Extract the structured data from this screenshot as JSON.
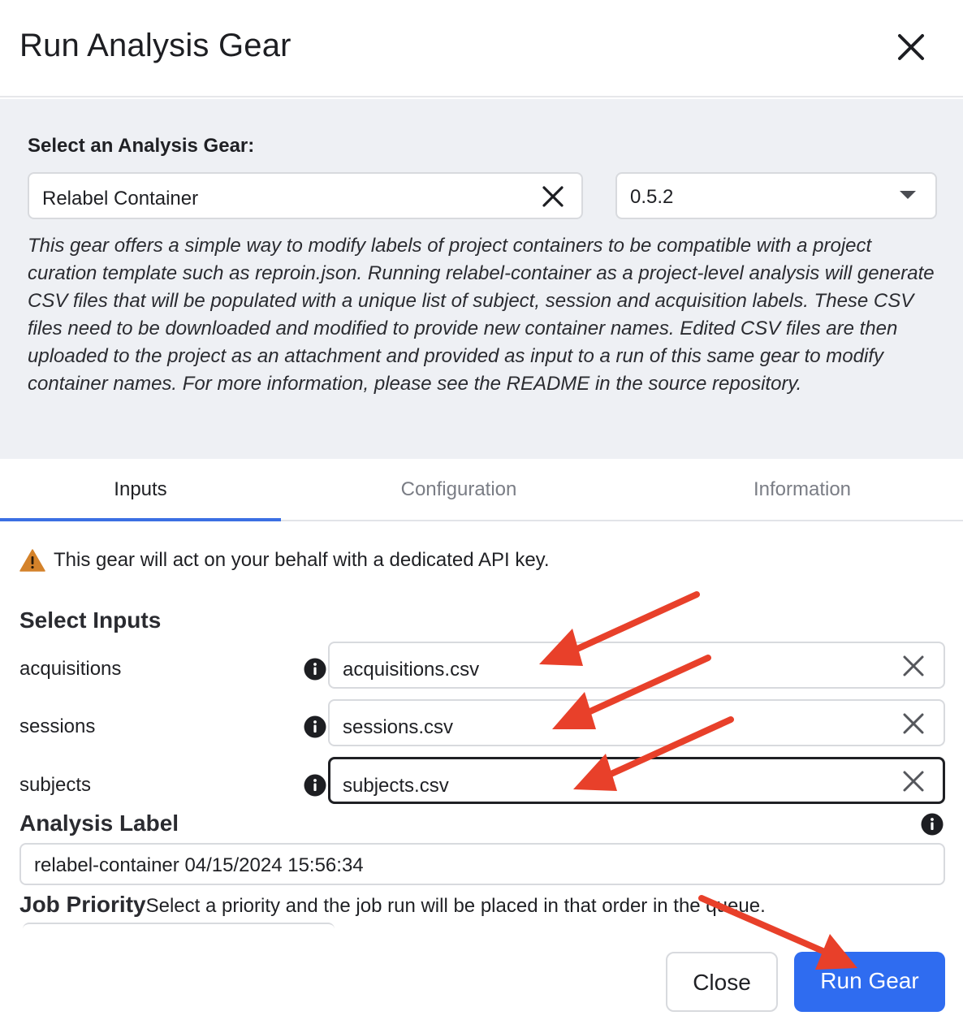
{
  "dialog": {
    "title": "Run Analysis Gear"
  },
  "gear_select": {
    "label": "Select an Analysis Gear:",
    "selected_gear": "Relabel Container",
    "version": "0.5.2",
    "description": "This gear offers a simple way to modify labels of project containers to be compatible with a project curation template such as reproin.json. Running relabel-container as a project-level analysis will generate CSV files that will be populated with a unique list of subject, session and acquisition labels. These CSV files need to be downloaded and modified to provide new container names. Edited CSV files are then uploaded to the project as an attachment and provided as input to a run of this same gear to modify container names. For more information, please see the README in the source repository."
  },
  "tabs": [
    {
      "label": "Inputs",
      "active": true
    },
    {
      "label": "Configuration",
      "active": false
    },
    {
      "label": "Information",
      "active": false
    }
  ],
  "warning": {
    "text": "This gear will act on your behalf with a dedicated API key."
  },
  "inputs": {
    "title": "Select Inputs",
    "rows": [
      {
        "label": "acquisitions",
        "value": "acquisitions.csv"
      },
      {
        "label": "sessions",
        "value": "sessions.csv"
      },
      {
        "label": "subjects",
        "value": "subjects.csv"
      }
    ]
  },
  "analysis_label": {
    "title": "Analysis Label",
    "value": "relabel-container 04/15/2024 15:56:34"
  },
  "job_priority": {
    "title": "Job Priority",
    "description": "Select a priority and the job run will be placed in that order in the queue."
  },
  "footer": {
    "close_label": "Close",
    "run_label": "Run Gear"
  },
  "colors": {
    "accent": "#2f6cf0",
    "tab_underline": "#3b6fe3",
    "annotation_arrow": "#e8402a",
    "warning": "#d4822a",
    "panel_bg": "#eef0f4"
  }
}
